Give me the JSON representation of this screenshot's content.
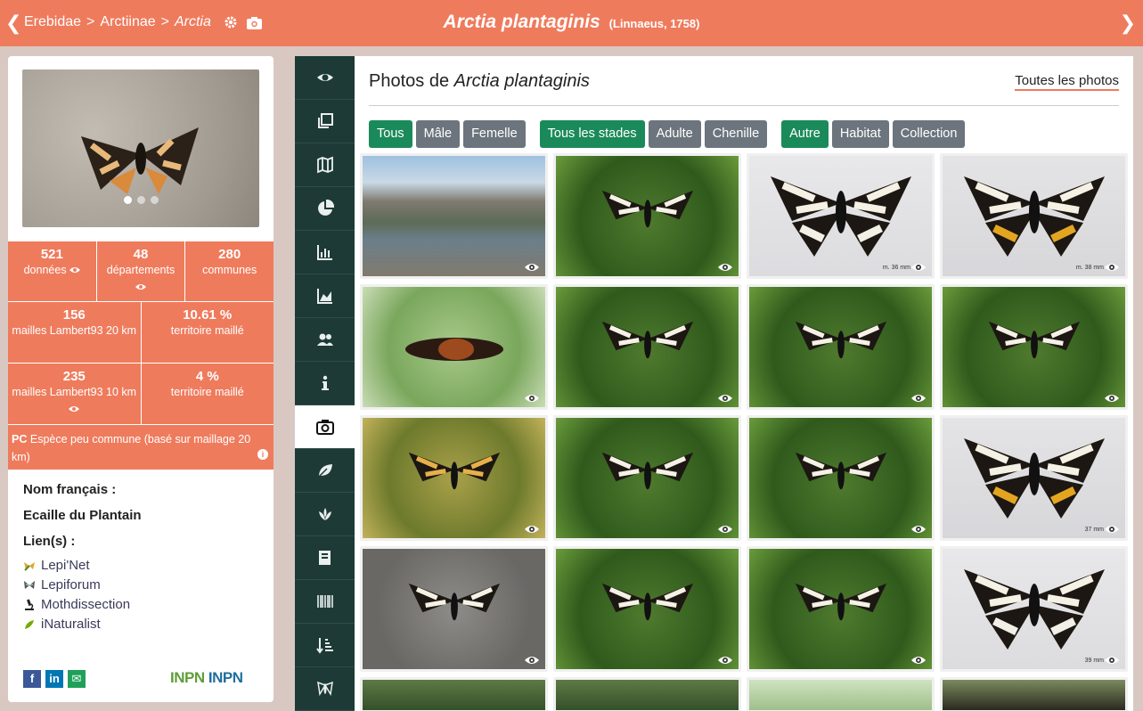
{
  "header": {
    "breadcrumb": [
      "Erebidae",
      "Arctiinae",
      "Arctia"
    ],
    "separator": ">",
    "title": "Arctia plantaginis",
    "author": "(Linnaeus, 1758)"
  },
  "stats": {
    "row1": [
      {
        "value": "521",
        "label": "données"
      },
      {
        "value": "48",
        "label": "départements"
      },
      {
        "value": "280",
        "label": "communes"
      }
    ],
    "row2": [
      {
        "value": "156",
        "label": "mailles Lambert93 20 km"
      },
      {
        "value": "10.61 %",
        "label": "territoire maillé"
      }
    ],
    "row3": [
      {
        "value": "235",
        "label": "mailles Lambert93 10 km"
      },
      {
        "value": "4 %",
        "label": "territoire maillé"
      }
    ],
    "rarity_code": "PC",
    "rarity_text": "Espèce peu commune (basé sur maillage 20 km)"
  },
  "names": {
    "french_heading": "Nom français :",
    "french_name": "Ecaille du Plantain",
    "links_heading": "Lien(s) :",
    "links": [
      "Lepi'Net",
      "Lepiforum",
      "Mothdissection",
      "iNaturalist"
    ]
  },
  "logo_text": {
    "a": "INPN",
    "b": "INPN"
  },
  "main": {
    "title_prefix": "Photos de ",
    "title_species": "Arctia plantaginis",
    "all_photos": "Toutes les photos"
  },
  "filters": {
    "sex": [
      "Tous",
      "Mâle",
      "Femelle"
    ],
    "stage": [
      "Tous les stades",
      "Adulte",
      "Chenille"
    ],
    "type": [
      "Autre",
      "Habitat",
      "Collection"
    ]
  },
  "photos": [
    {
      "kind": "landscape"
    },
    {
      "kind": "green"
    },
    {
      "kind": "collection-white",
      "scale": "m. 36 mm"
    },
    {
      "kind": "collection-yellow",
      "scale": "m. 38 mm"
    },
    {
      "kind": "caterpillar"
    },
    {
      "kind": "green"
    },
    {
      "kind": "green"
    },
    {
      "kind": "green"
    },
    {
      "kind": "orange"
    },
    {
      "kind": "green"
    },
    {
      "kind": "green"
    },
    {
      "kind": "collection-yellow",
      "scale": "37 mm"
    },
    {
      "kind": "grey"
    },
    {
      "kind": "green"
    },
    {
      "kind": "green"
    },
    {
      "kind": "collection-white",
      "scale": "39 mm"
    }
  ],
  "colors": {
    "header": "#ef7b5d",
    "rail": "#1d3a36",
    "filter_on": "#1b8a5a",
    "filter_off": "#6c757d"
  }
}
